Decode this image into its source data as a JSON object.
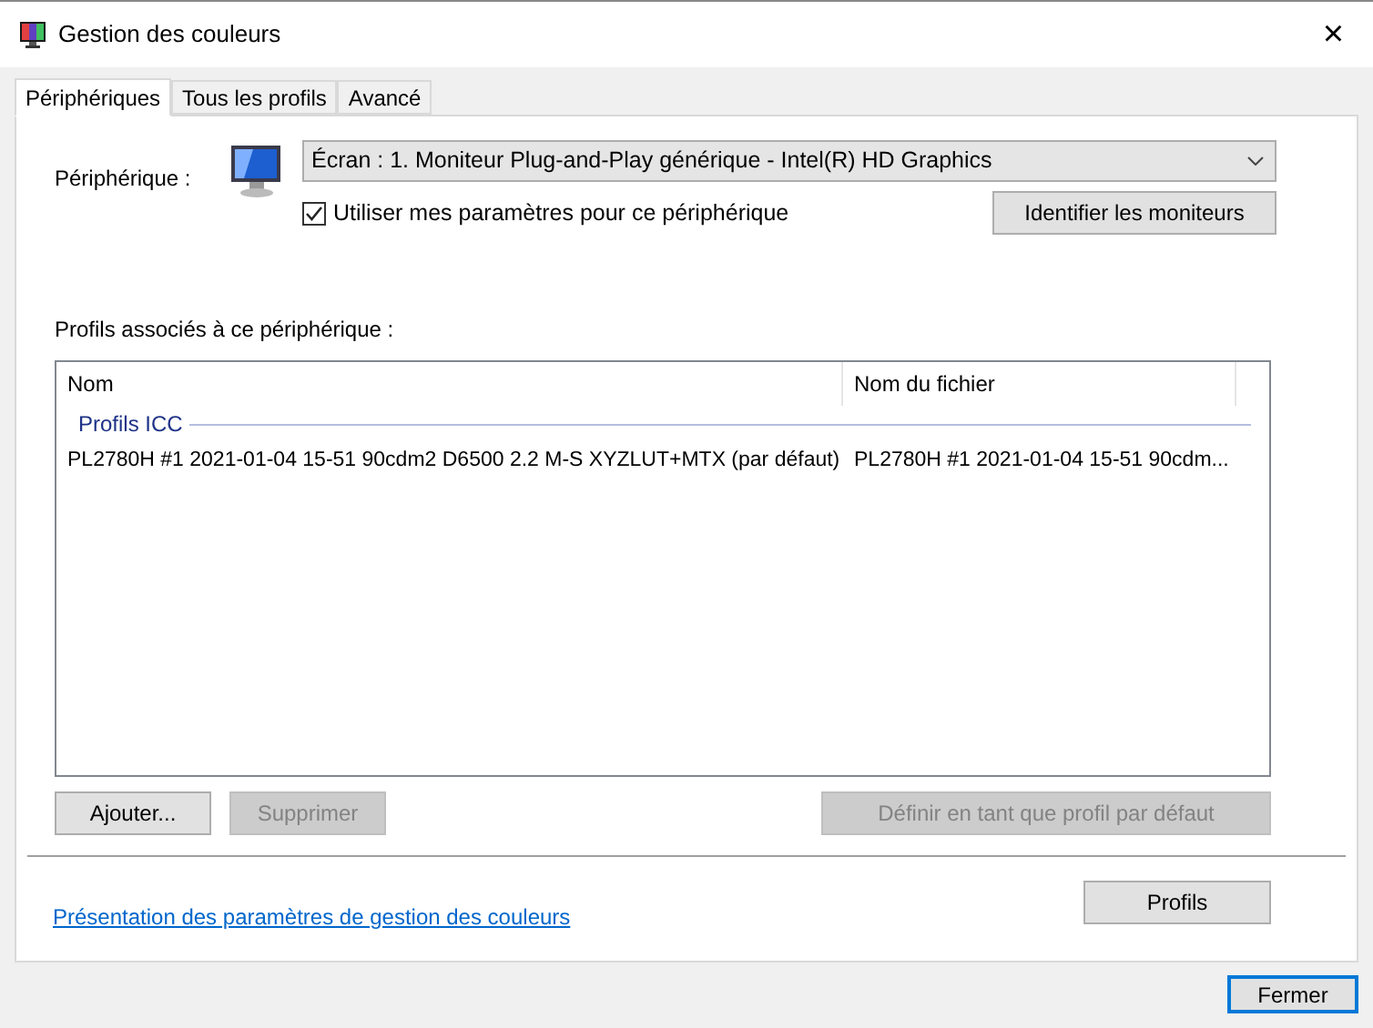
{
  "window": {
    "title": "Gestion des couleurs",
    "close": "×"
  },
  "tabs": [
    {
      "label": "Périphériques",
      "selected": true
    },
    {
      "label": "Tous les profils",
      "selected": false
    },
    {
      "label": "Avancé",
      "selected": false
    }
  ],
  "device": {
    "label": "Périphérique :",
    "value": "Écran : 1. Moniteur Plug-and-Play générique - Intel(R) HD Graphics"
  },
  "use_my_settings": {
    "label": "Utiliser mes paramètres pour ce périphérique",
    "checked": true
  },
  "identify_button": {
    "label": "Identifier les moniteurs",
    "disabled": false
  },
  "profiles": {
    "label": "Profils associés à ce périphérique :",
    "columns": [
      "Nom",
      "Nom du fichier"
    ],
    "groups": [
      {
        "title": "Profils ICC",
        "rows": [
          {
            "name": "PL2780H #1 2021-01-04 15-51 90cdm2 D6500 2.2 M-S XYZLUT+MTX (par défaut)",
            "file": "PL2780H #1 2021-01-04 15-51 90cdm..."
          }
        ]
      }
    ]
  },
  "list_buttons": [
    {
      "label": "Ajouter...",
      "disabled": false
    },
    {
      "label": "Supprimer",
      "disabled": true
    },
    {
      "label": "Définir en tant que profil par défaut",
      "disabled": true
    }
  ],
  "link": "Présentation des paramètres de gestion des couleurs",
  "profiles_button": {
    "label": "Profils",
    "disabled": false
  },
  "close_button": {
    "label": "Fermer",
    "disabled": false
  }
}
